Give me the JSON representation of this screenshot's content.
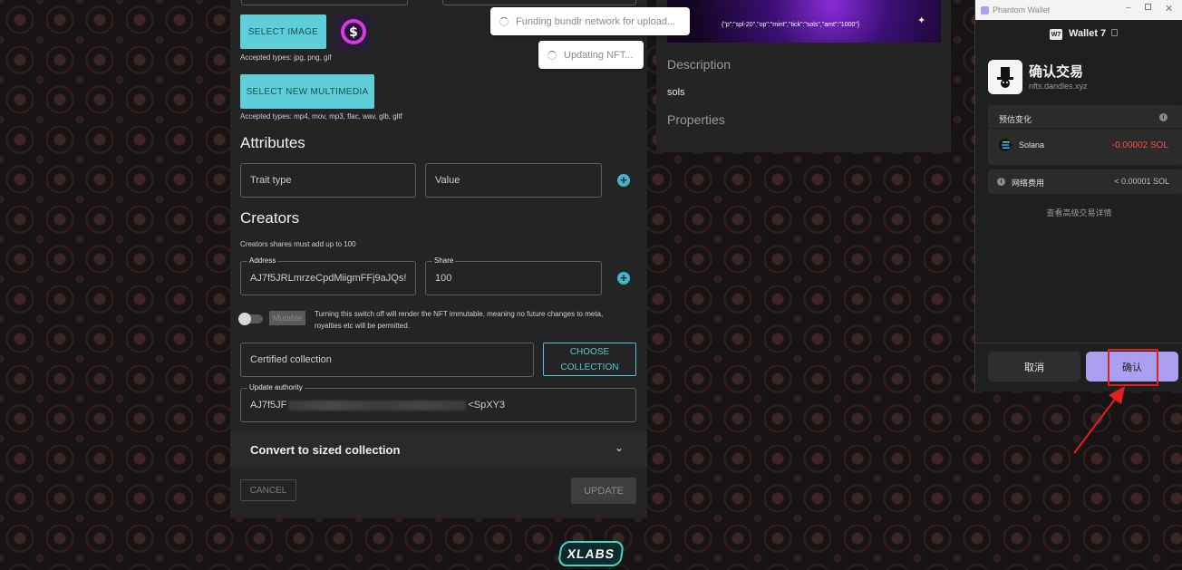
{
  "form": {
    "select_image_label": "SELECT IMAGE",
    "image_types_hint": "Accepted types: jpg, png, gif",
    "select_multimedia_label": "SELECT NEW MULTIMEDIA",
    "multimedia_types_hint": "Accepted types: mp4, mov, mp3, flac, wav, glb, gltf",
    "attributes_title": "Attributes",
    "trait_type_placeholder": "Trait type",
    "value_placeholder": "Value",
    "creators_title": "Creators",
    "creators_hint": "Creators shares must add up to 100",
    "address_label": "Address",
    "address_value": "AJ7f5JRLmrzeCpdMiigmFFj9aJQs!",
    "share_label": "Share",
    "share_value": "100",
    "mutable_label": "Mutable",
    "mutable_hint": "Turning this switch off will render the NFT immutable, meaning no future changes to meta, royalties etc will be permitted.",
    "certified_collection_placeholder": "Certified collection",
    "choose_collection_label": "CHOOSE COLLECTION",
    "update_authority_label": "Update authority",
    "update_authority_start": "AJ7f5JF",
    "update_authority_end": "<SpXY3",
    "convert_label": "Convert to sized collection",
    "cancel_label": "CANCEL",
    "update_label": "UPDATE"
  },
  "preview": {
    "json_text": "{\"p\":\"spl-20\",\"op\":\"mint\",\"tick\":\"sols\",\"amt\":\"1000\"}",
    "description_title": "Description",
    "description_value": "sols",
    "properties_title": "Properties"
  },
  "toasts": {
    "funding": "Funding bundlr network for upload...",
    "updating": "Updating NFT..."
  },
  "wallet": {
    "window_title": "Phantom Wallet",
    "badge": "W7",
    "wallet_name": "Wallet 7",
    "confirm_title": "确认交易",
    "site": "nfts.dandles.xyz",
    "estimated_changes": "预估变化",
    "token_name": "Solana",
    "token_change": "-0.00002 SOL",
    "network_fee_label": "网络费用",
    "network_fee_value": "< 0.00001 SOL",
    "advanced_details": "查看高级交易详情",
    "cancel_label": "取消",
    "confirm_label": "确认"
  },
  "footer": {
    "logo": "XLABS"
  },
  "colors": {
    "accent_teal": "#5ecfd8",
    "negative_red": "#ff4d4f",
    "phantom_purple": "#ab9ff2",
    "annotation_red": "#e02020"
  }
}
